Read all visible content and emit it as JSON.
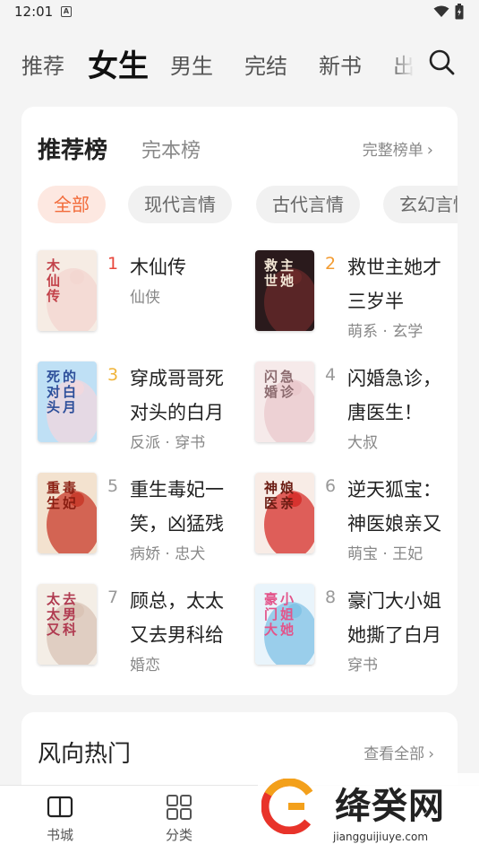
{
  "status_bar": {
    "time": "12:01",
    "a_icon_letter": "A"
  },
  "top_tabs": {
    "items": [
      "推荐",
      "女生",
      "男生",
      "完结",
      "新书",
      "出"
    ],
    "active_index": 1
  },
  "ranking": {
    "title": "推荐榜",
    "alt_title": "完本榜",
    "link_label": "完整榜单",
    "chevron": "›",
    "chips": [
      "全部",
      "现代言情",
      "古代言情",
      "玄幻言情"
    ],
    "active_chip": 0,
    "books": [
      {
        "rank": "1",
        "title": "木仙传",
        "tags": "仙侠"
      },
      {
        "rank": "2",
        "title": "救世主她才三岁半",
        "tags": "萌系 · 玄学"
      },
      {
        "rank": "3",
        "title": "穿成哥哥死对头的白月",
        "tags": "反派 · 穿书"
      },
      {
        "rank": "4",
        "title": "闪婚急诊，唐医生！",
        "tags": "大叔"
      },
      {
        "rank": "5",
        "title": "重生毒妃一笑，凶猛残",
        "tags": "病娇 · 忠犬"
      },
      {
        "rank": "6",
        "title": "逆天狐宝：神医娘亲又",
        "tags": "萌宝 · 王妃"
      },
      {
        "rank": "7",
        "title": "顾总，太太又去男科给",
        "tags": "婚恋"
      },
      {
        "rank": "8",
        "title": "豪门大小姐她撕了白月",
        "tags": "穿书"
      }
    ],
    "covers": [
      {
        "art_text": "木仙传",
        "colors": [
          "#f6ece4",
          "#f3d6d0",
          "#c2424a"
        ]
      },
      {
        "art_text": "救世主她",
        "colors": [
          "#2a1a1c",
          "#6a2a2a",
          "#f3e7d6"
        ]
      },
      {
        "art_text": "死对头的白月光",
        "colors": [
          "#bfe0f5",
          "#f2d7dd",
          "#2d4f9a"
        ]
      },
      {
        "art_text": "闪婚急诊",
        "colors": [
          "#f6eaea",
          "#e9c8cc",
          "#8b6a6e"
        ]
      },
      {
        "art_text": "重生毒妃",
        "colors": [
          "#f3e2cf",
          "#c83a2a",
          "#8a1e12"
        ]
      },
      {
        "art_text": "神医娘亲",
        "colors": [
          "#f8ece6",
          "#d62f2a",
          "#6b1b12"
        ]
      },
      {
        "art_text": "太太又去男科",
        "colors": [
          "#f4eee6",
          "#d9c3b5",
          "#b03a50"
        ]
      },
      {
        "art_text": "豪门大小姐她撕了白月光剧本",
        "colors": [
          "#e9f4fb",
          "#7fc2e6",
          "#e3548a"
        ]
      }
    ]
  },
  "trending": {
    "title": "风向热门",
    "link_label": "查看全部",
    "chevron": "›"
  },
  "bottom_nav": {
    "items": [
      {
        "label": "书城",
        "icon": "book-open-icon"
      },
      {
        "label": "分类",
        "icon": "grid-icon"
      }
    ]
  },
  "watermark": {
    "title": "绛癸网",
    "url": "jiangguijiuye.com"
  },
  "colors": {
    "accent": "#f26b3a",
    "accent_bg": "#fde8e1",
    "rank1": "#e8473c",
    "rank2": "#f39c32",
    "rank3": "#f0b43a"
  }
}
